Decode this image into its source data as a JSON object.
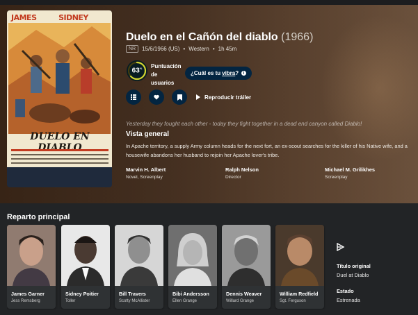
{
  "movie": {
    "title": "Duelo en el Cañón del diablo",
    "year": "(1966)",
    "certification": "NR",
    "release": "15/6/1966 (US)",
    "genre": "Western",
    "runtime": "1h 45m",
    "score_label_line1": "Puntuación",
    "score_label_line2": "de",
    "score_label_line3": "usuarios",
    "score_value": "63",
    "score_unit": "%",
    "score_fraction": 0.63,
    "vibe_prefix": "¿Cuál es tu",
    "vibe_link": "vibra",
    "vibe_suffix": "?",
    "trailer_label": "Reproducir tráiler",
    "tagline": "Yesterday they fought each other - today they fight together in a dead end canyon called Diablo!",
    "overview_heading": "Vista general",
    "overview": "In Apache territory, a supply Army column heads for the next fort, an ex-scout searches for the killer of his Native wife, and a housewife abandons her husband to rejoin her Apache lover's tribe.",
    "crew": [
      {
        "name": "Marvin H. Albert",
        "role": "Novel, Screenplay"
      },
      {
        "name": "Ralph Nelson",
        "role": "Director"
      },
      {
        "name": "Michael M. Grilikhes",
        "role": "Screenplay"
      }
    ]
  },
  "poster": {
    "name_left": "JAMES GARNER",
    "name_right": "SIDNEY POITIER",
    "title": "DUELO EN DIABLO"
  },
  "cast": {
    "heading": "Reparto principal",
    "members": [
      {
        "name": "James Garner",
        "character": "Jess Remsberg"
      },
      {
        "name": "Sidney Poitier",
        "character": "Toller"
      },
      {
        "name": "Bill Travers",
        "character": "Scotty McAllister"
      },
      {
        "name": "Bibi Andersson",
        "character": "Ellen Grange"
      },
      {
        "name": "Dennis Weaver",
        "character": "Willard Grange"
      },
      {
        "name": "William Redfield",
        "character": "Sgt. Ferguson"
      }
    ]
  },
  "facts": {
    "original_title_label": "Título original",
    "original_title": "Duel at Diablo",
    "status_label": "Estado",
    "status": "Estrenada"
  },
  "colors": {
    "brand_dark": "#032541",
    "score_ring": "#d2d531",
    "score_track": "#423d0f"
  },
  "icons": [
    "list-icon",
    "heart-icon",
    "bookmark-icon",
    "play-icon",
    "info-icon",
    "social-link-icon"
  ]
}
